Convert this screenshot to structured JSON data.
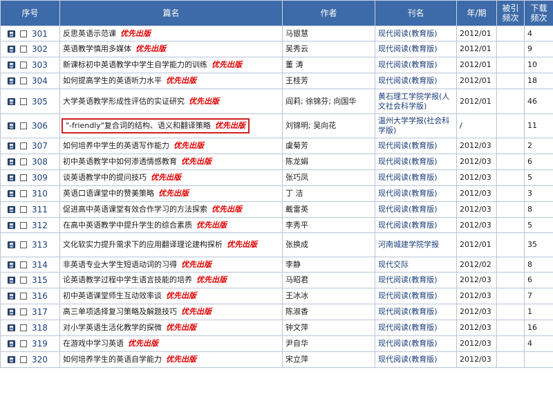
{
  "headers": {
    "seq": "序号",
    "title": "篇名",
    "author": "作者",
    "journal": "刊名",
    "date": "年/期",
    "cited": "被引频次",
    "downloads": "下载频次"
  },
  "priority_label": "优先出版",
  "rows": [
    {
      "num": "301",
      "title": "反思英语示范课",
      "priority": true,
      "author": "马银慧",
      "journal": "现代阅读(教育版)",
      "date": "2012/01",
      "cited": "",
      "downloads": "4"
    },
    {
      "num": "302",
      "title": "英语教学慎用多媒体",
      "priority": true,
      "author": "吴秀云",
      "journal": "现代阅读(教育版)",
      "date": "2012/01",
      "cited": "",
      "downloads": "9"
    },
    {
      "num": "303",
      "title": "新课标初中英语教学中学生自学能力的训练",
      "priority": true,
      "author": "董  涛",
      "journal": "现代阅读(教育版)",
      "date": "2012/01",
      "cited": "",
      "downloads": "10"
    },
    {
      "num": "304",
      "title": "如何提高学生的英语听力水平",
      "priority": true,
      "author": "王桂芳",
      "journal": "现代阅读(教育版)",
      "date": "2012/01",
      "cited": "",
      "downloads": "18"
    },
    {
      "num": "305",
      "title": "大学英语教学形成性评估的实证研究",
      "priority": true,
      "author": "阎莉; 徐锦芬; 向国华",
      "journal": "黄石理工学院学报(人文社会科学版)",
      "date": "2012/01",
      "cited": "",
      "downloads": "46"
    },
    {
      "num": "306",
      "title": "\"-friendly\"复合词的结构、语义和翻译策略",
      "priority": true,
      "highlight": true,
      "author": "刘锦明; 吴向花",
      "journal": "温州大学学报(社会科学版)",
      "date": "/",
      "cited": "",
      "downloads": "11"
    },
    {
      "num": "307",
      "title": "如何培养中学生的英语写作能力",
      "priority": true,
      "author": "虞菊芳",
      "journal": "现代阅读(教育版)",
      "date": "2012/03",
      "cited": "",
      "downloads": "2"
    },
    {
      "num": "308",
      "title": "初中英语教学中如何渗透情感教育",
      "priority": true,
      "author": "陈龙娟",
      "journal": "现代阅读(教育版)",
      "date": "2012/03",
      "cited": "",
      "downloads": "6"
    },
    {
      "num": "309",
      "title": "谈英语教学中的提问技巧",
      "priority": true,
      "author": "张巧凤",
      "journal": "现代阅读(教育版)",
      "date": "2012/03",
      "cited": "",
      "downloads": "5"
    },
    {
      "num": "310",
      "title": "英语口语课堂中的赞美策略",
      "priority": true,
      "author": "丁  洁",
      "journal": "现代阅读(教育版)",
      "date": "2012/03",
      "cited": "",
      "downloads": "3"
    },
    {
      "num": "311",
      "title": "促进高中英语课堂有效合作学习的方法探索",
      "priority": true,
      "author": "戴雷英",
      "journal": "现代阅读(教育版)",
      "date": "2012/03",
      "cited": "",
      "downloads": "8"
    },
    {
      "num": "312",
      "title": "在高中英语教学中提升学生的综合素质",
      "priority": true,
      "author": "李秀平",
      "journal": "现代阅读(教育版)",
      "date": "2012/03",
      "cited": "",
      "downloads": "5"
    },
    {
      "num": "313",
      "title": "文化软实力提升需求下的应用翻译理论建构探析",
      "priority": true,
      "author": "张换成",
      "journal": "河南城建学院学报",
      "date": "2012/01",
      "cited": "",
      "downloads": "35"
    },
    {
      "num": "314",
      "title": "非英语专业大学生短语动词的习得",
      "priority": true,
      "author": "李静",
      "journal": "现代交际",
      "date": "2012/02",
      "cited": "",
      "downloads": "8"
    },
    {
      "num": "315",
      "title": "论英语教学过程中学生语言技能的培养",
      "priority": true,
      "author": "马昭君",
      "journal": "现代阅读(教育版)",
      "date": "2012/03",
      "cited": "",
      "downloads": "6"
    },
    {
      "num": "316",
      "title": "初中英语课堂师生互动效率谈",
      "priority": true,
      "author": "王冰冰",
      "journal": "现代阅读(教育版)",
      "date": "2012/03",
      "cited": "",
      "downloads": "7"
    },
    {
      "num": "317",
      "title": "高三单项选择复习策略及解题技巧",
      "priority": true,
      "author": "陈淑香",
      "journal": "现代阅读(教育版)",
      "date": "2012/03",
      "cited": "",
      "downloads": "1"
    },
    {
      "num": "318",
      "title": "对小学英语生活化教学的探微",
      "priority": true,
      "author": "钟文萍",
      "journal": "现代阅读(教育版)",
      "date": "2012/03",
      "cited": "",
      "downloads": "16"
    },
    {
      "num": "319",
      "title": "在游戏中学习英语",
      "priority": true,
      "author": "尹自华",
      "journal": "现代阅读(教育版)",
      "date": "2012/03",
      "cited": "",
      "downloads": "4"
    },
    {
      "num": "320",
      "title": "如何培养学生的英语自学能力",
      "priority": true,
      "author": "宋立萍",
      "journal": "现代阅读(教育版)",
      "date": "2012/03",
      "cited": "",
      "downloads": ""
    }
  ]
}
